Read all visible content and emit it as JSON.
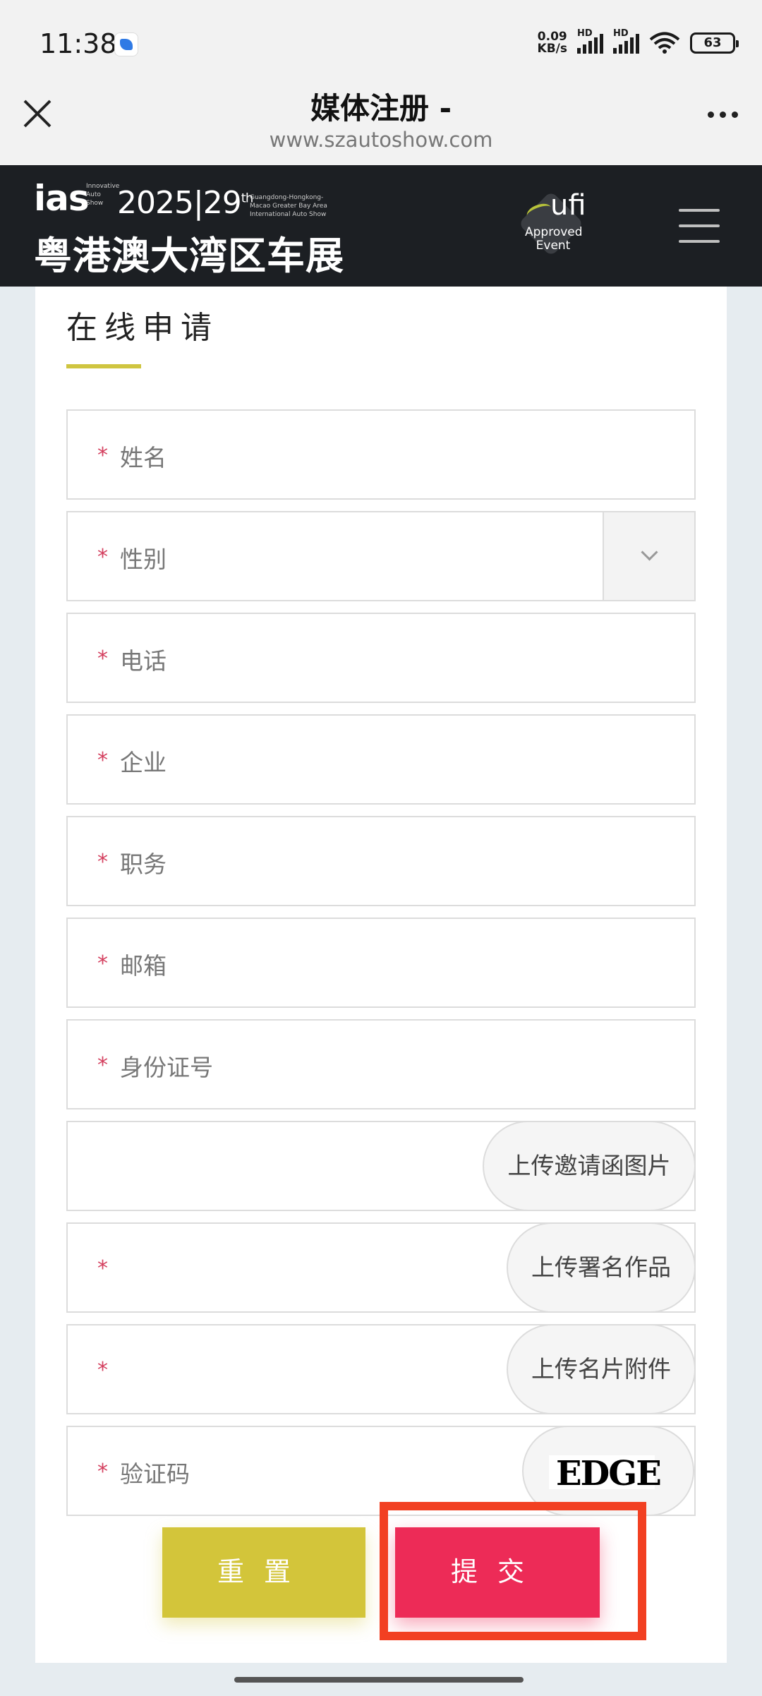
{
  "status_bar": {
    "time": "11:38",
    "net_speed_value": "0.09",
    "net_speed_unit": "KB/s",
    "signal_tag": "HD",
    "battery": "63"
  },
  "browser": {
    "title": "媒体注册 -",
    "url": "www.szautoshow.com"
  },
  "site": {
    "logo_mark": "ias",
    "logo_mark_sub": "Innovative Auto Show",
    "logo_year": "2025|29",
    "logo_year_sup": "th",
    "logo_desc": "Guangdong-Hongkong-Macao Greater Bay Area International Auto Show",
    "logo_cn": "粤港澳大湾区车展",
    "badge_name": "ufi",
    "badge_sub": "Approved Event"
  },
  "form": {
    "section_title": "在线申请",
    "required_mark": "*",
    "fields": [
      {
        "placeholder": "姓名",
        "required": true
      },
      {
        "placeholder": "性别",
        "required": true,
        "type": "select"
      },
      {
        "placeholder": "电话",
        "required": true
      },
      {
        "placeholder": "企业",
        "required": true
      },
      {
        "placeholder": "职务",
        "required": true
      },
      {
        "placeholder": "邮箱",
        "required": true
      },
      {
        "placeholder": "身份证号",
        "required": true
      }
    ],
    "uploads": [
      {
        "label": "上传邀请函图片",
        "required": false
      },
      {
        "label": "上传署名作品",
        "required": true
      },
      {
        "label": "上传名片附件",
        "required": true
      }
    ],
    "captcha": {
      "placeholder": "验证码",
      "code": "EDGE"
    },
    "reset_label": "重置",
    "submit_label": "提交"
  }
}
